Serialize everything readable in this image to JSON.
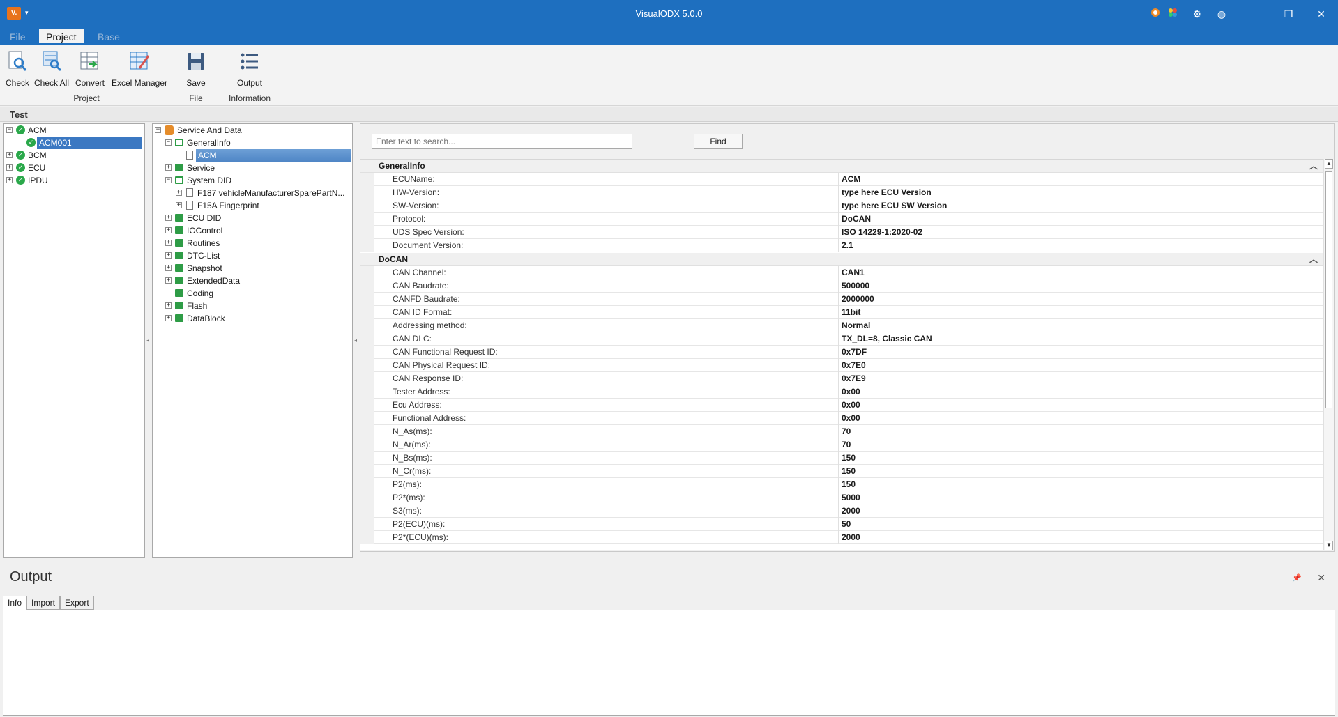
{
  "window": {
    "title": "VisualODX 5.0.0",
    "logo_text": "V."
  },
  "menu": {
    "tabs": [
      "File",
      "Project",
      "Base"
    ]
  },
  "ribbon": {
    "check": "Check",
    "check_all": "Check All",
    "convert": "Convert",
    "excel_manager": "Excel Manager",
    "save": "Save",
    "output": "Output",
    "group_project": "Project",
    "group_file": "File",
    "group_information": "Information"
  },
  "panel": {
    "title": "Test"
  },
  "ecu_tree": {
    "items": [
      "ACM",
      "ACM001",
      "BCM",
      "ECU",
      "IPDU"
    ]
  },
  "service_tree": {
    "root": "Service And Data",
    "general_info": "GeneralInfo",
    "acm": "ACM",
    "service": "Service",
    "system_did": "System DID",
    "f187": "F187 vehicleManufacturerSparePartN...",
    "f15a": "F15A Fingerprint",
    "ecu_did": "ECU DID",
    "iocontrol": "IOControl",
    "routines": "Routines",
    "dtc_list": "DTC-List",
    "snapshot": "Snapshot",
    "extended_data": "ExtendedData",
    "coding": "Coding",
    "flash": "Flash",
    "datablock": "DataBlock"
  },
  "search": {
    "placeholder": "Enter text to search...",
    "find_label": "Find"
  },
  "property_grid": {
    "general_title": "GeneralInfo",
    "general": [
      {
        "name": "ECUName:",
        "value": "ACM"
      },
      {
        "name": "HW-Version:",
        "value": "type here ECU Version"
      },
      {
        "name": "SW-Version:",
        "value": "type here ECU SW Version"
      },
      {
        "name": "Protocol:",
        "value": "DoCAN"
      },
      {
        "name": "UDS Spec Version:",
        "value": "ISO 14229-1:2020-02"
      },
      {
        "name": "Document Version:",
        "value": "2.1"
      }
    ],
    "docan_title": "DoCAN",
    "docan": [
      {
        "name": "CAN Channel:",
        "value": "CAN1"
      },
      {
        "name": "CAN Baudrate:",
        "value": "500000"
      },
      {
        "name": "CANFD Baudrate:",
        "value": "2000000"
      },
      {
        "name": "CAN ID Format:",
        "value": "11bit"
      },
      {
        "name": "Addressing method:",
        "value": "Normal"
      },
      {
        "name": "CAN DLC:",
        "value": "TX_DL=8, Classic CAN"
      },
      {
        "name": "CAN Functional Request ID:",
        "value": "0x7DF"
      },
      {
        "name": "CAN Physical Request ID:",
        "value": "0x7E0"
      },
      {
        "name": "CAN Response ID:",
        "value": "0x7E9"
      },
      {
        "name": "Tester Address:",
        "value": "0x00"
      },
      {
        "name": "Ecu Address:",
        "value": "0x00"
      },
      {
        "name": "Functional Address:",
        "value": "0x00"
      },
      {
        "name": "N_As(ms):",
        "value": "70"
      },
      {
        "name": "N_Ar(ms):",
        "value": "70"
      },
      {
        "name": "N_Bs(ms):",
        "value": "150"
      },
      {
        "name": "N_Cr(ms):",
        "value": "150"
      },
      {
        "name": "P2(ms):",
        "value": "150"
      },
      {
        "name": "P2*(ms):",
        "value": "5000"
      },
      {
        "name": "S3(ms):",
        "value": "2000"
      },
      {
        "name": "P2(ECU)(ms):",
        "value": "50"
      },
      {
        "name": "P2*(ECU)(ms):",
        "value": "2000"
      }
    ]
  },
  "output": {
    "title": "Output",
    "tabs": [
      "Info",
      "Import",
      "Export"
    ]
  }
}
